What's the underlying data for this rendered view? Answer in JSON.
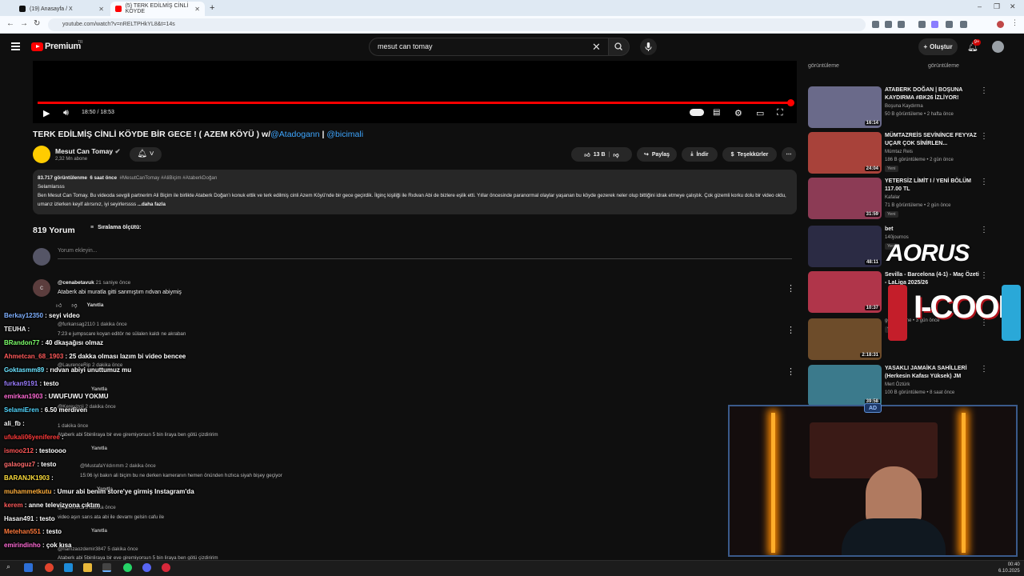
{
  "browser": {
    "tabs": [
      {
        "label": "(19) Anasayfa / X",
        "active": false
      },
      {
        "label": "(5) TERK EDİLMİŞ CİNLİ KÖYDE",
        "active": true
      }
    ],
    "url": "youtube.com/watch?v=nRELTPHkYL8&t=14s"
  },
  "youtube": {
    "logo_text": "Premium",
    "region": "TR",
    "search_value": "mesut can tomay",
    "create_label": "Oluştur",
    "notification_count": "9+"
  },
  "player": {
    "time": "18:50 / 18:53",
    "progress": 0.997
  },
  "video": {
    "title": "TERK EDİLMİŞ CİNLİ KÖYDE BİR GECE ! ( AZEM KÖYÜ ) w/",
    "title_link1": "@Atadogann",
    "title_sep": " | ",
    "title_link2": "@bicimali",
    "channel": "Mesut Can Tomay",
    "subscribers": "2,32 Mn abone",
    "likes": "13 B",
    "share": "Paylaş",
    "download": "İndir",
    "thanks": "Teşekkürler"
  },
  "description": {
    "views": "83.717 görüntülenme",
    "time": "6 saat önce",
    "tags": "#MesutCanTomay #AliBiçim #AtaberkDoğan",
    "greeting": "Selamlarsss",
    "text": "Ben Mesut Can Tomay. Bu videoda sevgili partnerim Ali Biçim ile birlikte Ataberk Doğan'ı konuk ettik ve terk edilmiş cinli Azem Köyü'nde bir gece geçirdik. İlginç kişiliği ile Rıdvan Abi de bizlere eşlik etti. Yıllar öncesinde paranormal olaylar yaşanan bu köyde gezerek neler olup bittiğini idrak etmeye çalıştık. Çok gizemli korku dolu bir video oldu, umarız izlerken keyif alırsınız, iyi seyirlerssss",
    "more": "...daha fazla"
  },
  "comments": {
    "count": "819 Yorum",
    "sort_label": "Sıralama ölçütü:",
    "input_placeholder": "Yorum ekleyin...",
    "first": {
      "avatar_letter": "c",
      "author": "@cenabetavuk",
      "time": "21 saniye önce",
      "text": "Ataberk abi muratla gitti sanmıştım rıdvan abiymiş",
      "reply": "Yanıtla"
    },
    "background": [
      {
        "author": "@furkansag2110",
        "time": "1 dakika önce",
        "text": "7:23 e jumpscare koyan editör ne sülalen kaldı ne akraban"
      },
      {
        "author": "@LaurenceRip",
        "time": "2 dakika önce",
        "text": ""
      },
      {
        "author": "@Kerevizcii",
        "time": "2 dakika önce",
        "text": ""
      },
      {
        "author": "@hamzaozdemir3847",
        "time": "1 dakika önce",
        "text": "Ataberk abi 5binliraya bir eve giremiyorsun 5 bin liraya ben götü çizdiririm"
      },
      {
        "author": "@MustafaYıldırımm",
        "time": "2 dakika önce",
        "text": "15:06 iyi bakın ali biçim bu ne derken kameranın hemen önünden hızlıca siyah bişey geçiyor"
      },
      {
        "author": "@Kerevizcii",
        "time": "3 dakika önce",
        "text": "video aşırı sarıs ata abi ile devamı gelsin cafu ile"
      },
      {
        "author": "@hamzaozdemir3847",
        "time": "5 dakika önce",
        "text": "Ataberk abi 5binliraya bir eve giremiyorsun 5 bin liraya ben götü çizdiririm"
      }
    ]
  },
  "chat": [
    {
      "user": "Berkay12350",
      "msg": "seyi video",
      "color": "#7fb0ff"
    },
    {
      "user": "TEUHA",
      "msg": "",
      "color": "#f2f2f2"
    },
    {
      "user": "BRandon77",
      "msg": "40 dkaşağısı olmaz",
      "color": "#7dff6a"
    },
    {
      "user": "Ahmetcan_68_1903",
      "msg": "25 dakka olması lazım bi video bencee",
      "color": "#ff5a5a"
    },
    {
      "user": "Goktasmm89",
      "msg": "rıdvan abiyi unuttumuz mu",
      "color": "#6be3ff"
    },
    {
      "user": "furkan9191",
      "msg": "testo",
      "color": "#9b7dff"
    },
    {
      "user": "emirkan1903",
      "msg": "UWUFUWU YOKMU",
      "color": "#ff6ad5"
    },
    {
      "user": "SelamiEren",
      "msg": "6.50 merdiven",
      "color": "#53d7ff"
    },
    {
      "user": "ali_fb",
      "msg": "",
      "color": "#f2f2f2"
    },
    {
      "user": "ufukali06yeniferee",
      "msg": "",
      "color": "#ff3a3a"
    },
    {
      "user": "ismoo212",
      "msg": "testoooo",
      "color": "#ff5757"
    },
    {
      "user": "galaoguz7",
      "msg": "testo",
      "color": "#ff6b6b"
    },
    {
      "user": "BARANJK1903",
      "msg": "",
      "color": "#ffdf3c"
    },
    {
      "user": "muhammetkutu",
      "msg": "Umur abi benim store'ye girmiş Instagram'da",
      "color": "#ffae3c"
    },
    {
      "user": "kerem",
      "msg": "anne televizyona çıktım",
      "color": "#ff5a5a"
    },
    {
      "user": "Hasan491",
      "msg": "testo",
      "color": "#f2f2f2"
    },
    {
      "user": "Metehan551",
      "msg": "testo",
      "color": "#ff7a3c"
    },
    {
      "user": "emirindinho",
      "msg": "çok kısa",
      "color": "#ff6ad5"
    }
  ],
  "sidebar": {
    "top_views1": "görüntüleme",
    "top_views2": "görüntüleme",
    "items": [
      {
        "title": "ATABERK DOĞAN | BOŞUNA KAYDIRMA #BK26 İZLİYOR!",
        "channel": "Boşuna Kaydırma",
        "meta": "50 B görüntüleme • 2 hafta önce",
        "duration": "16:14",
        "thumb": "#6a6a8a",
        "new": ""
      },
      {
        "title": "MÜMTAZREİS SEVİNİNCE FEYYAZ UÇAR ÇOK SİNİRLEN...",
        "channel": "Mümtaz Reis",
        "meta": "186 B görüntüleme • 2 gün önce",
        "duration": "24:04",
        "thumb": "#a8423a",
        "new": "Yeni"
      },
      {
        "title": "YETERSİZ LİMİT I / YENİ BÖLÜM 117.00 TL",
        "channel": "Kafalar",
        "meta": "71 B görüntüleme • 2 gün önce",
        "duration": "31:59",
        "thumb": "#8c3b55",
        "new": "Yeni"
      },
      {
        "title": "bet",
        "channel": "140journos",
        "meta": "",
        "duration": "48:11",
        "thumb": "#2b2b44",
        "new": "Yeni"
      },
      {
        "title": "Sevilla - Barcelona (4-1) - Maç Özeti - LaLiga 2025/26",
        "channel": "",
        "meta": "",
        "duration": "10:37",
        "thumb": "#b0354a",
        "new": ""
      },
      {
        "title": "",
        "channel": "",
        "meta": "görüntüleme • 3 gün önce",
        "duration": "2:18:31",
        "thumb": "#6d4c2a",
        "new": "Yeni"
      },
      {
        "title": "YASAKLI JAMAİKA SAHİLLERİ (Herkesin Kafası Yüksek) JM",
        "channel": "Mert Öztürk",
        "meta": "100 B görüntüleme • 8 saat önce",
        "duration": "39:58",
        "thumb": "#3b7a8c",
        "new": ""
      }
    ]
  },
  "overlay": {
    "aorus": "AORUS",
    "icool": "I-COOL",
    "cam_badge": "AD"
  },
  "taskbar": {
    "time": "00:40",
    "date": "6.10.2025"
  }
}
